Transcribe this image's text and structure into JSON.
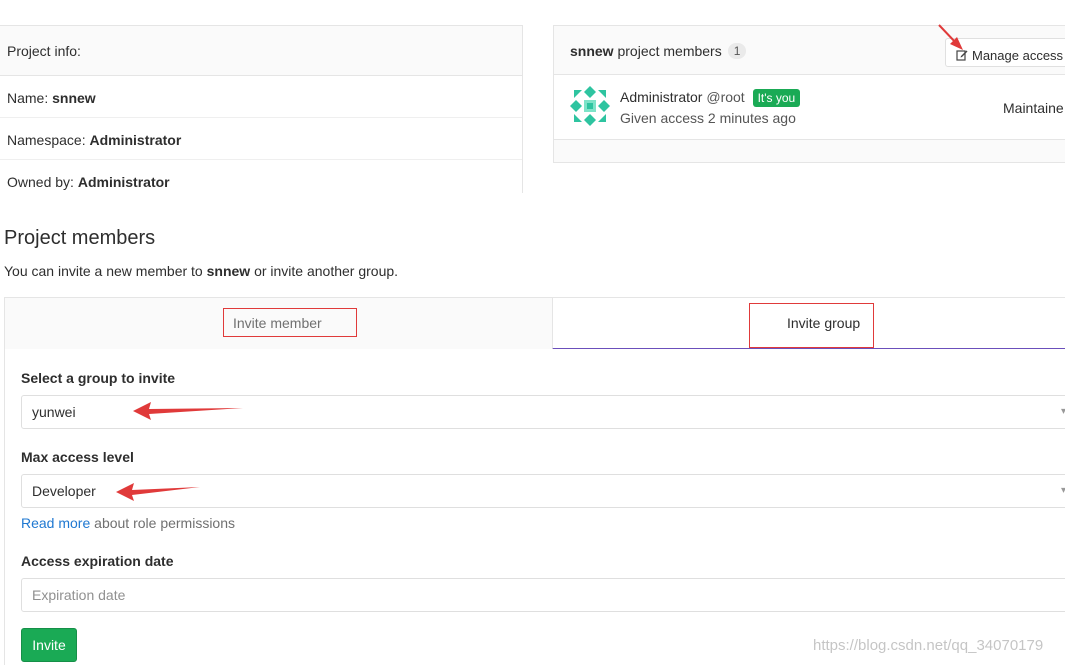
{
  "project_info": {
    "header": "Project info:",
    "rows": [
      {
        "label": "Name: ",
        "value": "snnew"
      },
      {
        "label": "Namespace: ",
        "value": "Administrator"
      },
      {
        "label": "Owned by: ",
        "value": "Administrator"
      }
    ]
  },
  "members_panel": {
    "project": "snnew",
    "title_suffix": " project members",
    "count": "1",
    "manage_label": "Manage access",
    "member": {
      "name": "Administrator",
      "handle": "@root",
      "you_badge": "It's you",
      "access": "Given access 2 minutes ago",
      "role": "Maintaine"
    }
  },
  "section": {
    "title": "Project members",
    "desc_prefix": "You can invite a new member to ",
    "desc_project": "snnew",
    "desc_suffix": " or invite another group."
  },
  "tabs": {
    "invite_member": "Invite member",
    "invite_group": "Invite group"
  },
  "form": {
    "group_label": "Select a group to invite",
    "group_value": "yunwei",
    "access_label": "Max access level",
    "access_value": "Developer",
    "help_link": "Read more",
    "help_suffix": " about role permissions",
    "expiration_label": "Access expiration date",
    "expiration_placeholder": "Expiration date",
    "invite_button": "Invite"
  },
  "watermark": "https://blog.csdn.net/qq_34070179",
  "colors": {
    "accent_tab": "#6b4fbb",
    "success": "#1aaa55",
    "annotation": "#e03a3a",
    "link": "#1f78d1"
  }
}
